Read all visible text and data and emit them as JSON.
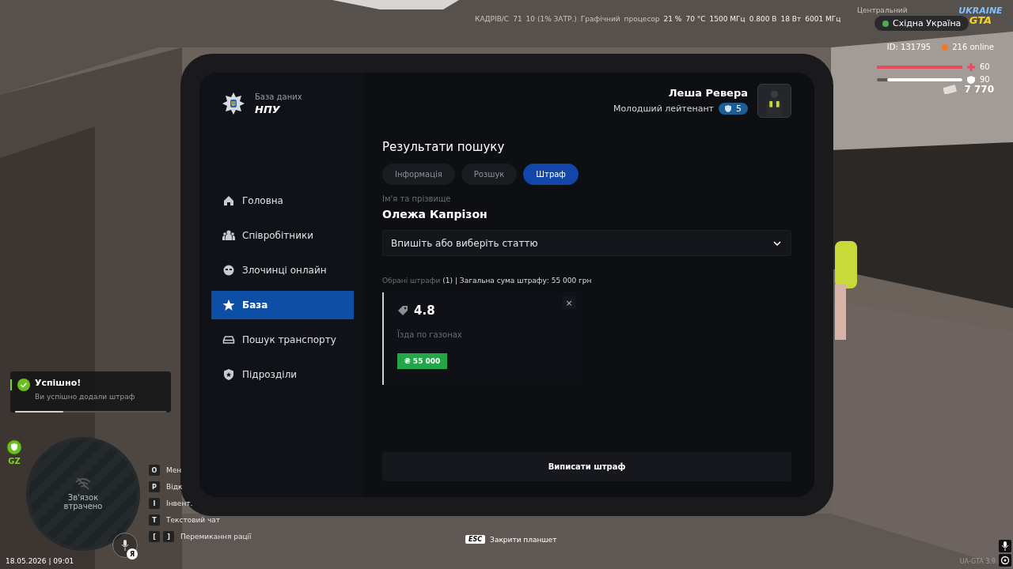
{
  "perf_overlay": [
    "КАДРІВ/С",
    "71",
    "10 (1% ЗАТР.)",
    "Графічний",
    "процесор",
    "21 %",
    "70 °C",
    "1500 МГц",
    "0.800 В",
    "18 Вт",
    "6001 МГц"
  ],
  "perf_cpu_label": "Центральний",
  "server": {
    "region": "Східна Україна",
    "logo_top": "UKRAINE",
    "logo_bottom": "GTA"
  },
  "player_hud": {
    "id": "ID: 131795",
    "online": "216 online",
    "health": {
      "level": 1.0,
      "reading": "60"
    },
    "armor": {
      "level": 0.88,
      "reading": "90"
    },
    "money": "7 770"
  },
  "notification": {
    "title": "Успішно!",
    "message": "Ви успішно додали штраф",
    "level": 0.32
  },
  "zone": {
    "label": "GZ"
  },
  "minimap": {
    "status": "Зв'язок втрачено",
    "voice_key": "Я"
  },
  "keybinds": [
    {
      "keys": [
        "O"
      ],
      "label": "Мен"
    },
    {
      "keys": [
        "P"
      ],
      "label": "Відк"
    },
    {
      "keys": [
        "I"
      ],
      "label": "Інвент."
    },
    {
      "keys": [
        "T"
      ],
      "label": "Текстовий чат"
    },
    {
      "keys": [
        "[",
        "]"
      ],
      "label": "Перемикання рації"
    }
  ],
  "datetime": "18.05.2026 | 09:01",
  "close_hint": {
    "key": "ESC",
    "label": "Закрити планшет"
  },
  "version": "UA-GTA 3.9",
  "tablet": {
    "brand": {
      "subtitle": "База даних",
      "title": "НПУ"
    },
    "sidebar": {
      "items": [
        {
          "label": "Головна",
          "selected": false
        },
        {
          "label": "Співробітники",
          "selected": false
        },
        {
          "label": "Злочинці онлайн",
          "selected": false
        },
        {
          "label": "База",
          "selected": true
        },
        {
          "label": "Пошук транспорту",
          "selected": false
        },
        {
          "label": "Підрозділи",
          "selected": false
        }
      ]
    },
    "user": {
      "name": "Леша Ревера",
      "rank": "Молодший лейтенант",
      "level": "5"
    },
    "title": "Результати пошуку",
    "tabs": [
      {
        "label": "Інформація",
        "selected": false
      },
      {
        "label": "Розшук",
        "selected": false
      },
      {
        "label": "Штраф",
        "selected": true
      }
    ],
    "person": {
      "label": "Ім'я та прізвище",
      "value": "Олежа Капрізон"
    },
    "article_select": {
      "placeholder": "Впишіть або виберіть статтю"
    },
    "summary": {
      "label": "Обрані штрафи",
      "count": "(1) | Загальна сума штрафу: 55 000 грн"
    },
    "fines": [
      {
        "code": "4.8",
        "description": "Їзда по газонах",
        "amount": "₴ 55 000",
        "remove": "×"
      }
    ],
    "submit": "Виписати штраф"
  }
}
